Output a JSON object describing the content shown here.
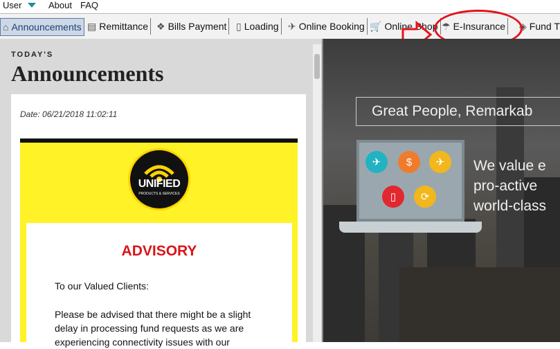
{
  "menu": {
    "user": "User",
    "about": "About",
    "faq": "FAQ"
  },
  "tabs": [
    {
      "label": "Announcements",
      "icon": "home-icon"
    },
    {
      "label": "Remittance",
      "icon": "remittance-icon"
    },
    {
      "label": "Bills Payment",
      "icon": "bills-icon"
    },
    {
      "label": "Loading",
      "icon": "phone-icon"
    },
    {
      "label": "Online Booking",
      "icon": "plane-icon"
    },
    {
      "label": "Online Shop",
      "icon": "cart-icon"
    },
    {
      "label": "E-Insurance",
      "icon": "insurance-icon"
    },
    {
      "label": "Fund T",
      "icon": "fund-icon"
    }
  ],
  "announcements": {
    "kicker": "TODAY'S",
    "title": "Announcements",
    "date": "Date:  06/21/2018 11:02:11",
    "logo_main": "UNIFIED",
    "logo_sub": "PRODUCTS & SERVICES",
    "advisory": "ADVISORY",
    "greeting": "To our Valued Clients:",
    "body": [
      "Please be advised that there might be a slight",
      "delay in processing fund requests as we are",
      "experiencing connectivity issues with our"
    ]
  },
  "hero": {
    "tagline": "Great People, Remarkab",
    "lines": [
      "We value e",
      "pro-active",
      "world-class"
    ]
  },
  "colors": {
    "annotation": "#e4141b",
    "advisory": "#d8151b",
    "yellow": "#fff227"
  }
}
